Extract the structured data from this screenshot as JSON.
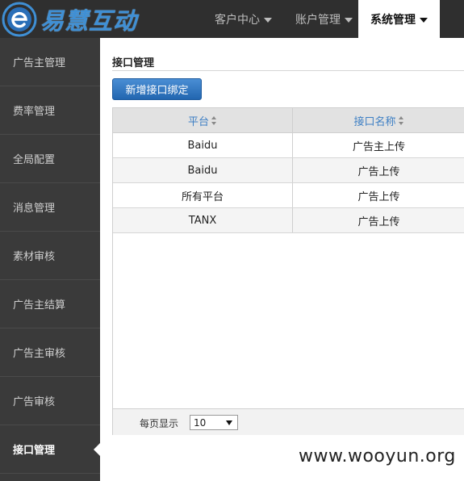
{
  "brand": {
    "logo_text": "易慧互动"
  },
  "nav": {
    "items": [
      {
        "label": "客户中心"
      },
      {
        "label": "账户管理"
      },
      {
        "label": "系统管理"
      }
    ]
  },
  "sidebar": {
    "items": [
      {
        "label": "广告主管理"
      },
      {
        "label": "费率管理"
      },
      {
        "label": "全局配置"
      },
      {
        "label": "消息管理"
      },
      {
        "label": "素材审核"
      },
      {
        "label": "广告主结算"
      },
      {
        "label": "广告主审核"
      },
      {
        "label": "广告审核"
      },
      {
        "label": "接口管理"
      }
    ]
  },
  "main": {
    "title": "接口管理",
    "add_button": "新增接口绑定",
    "table": {
      "columns": [
        "平台",
        "接口名称"
      ],
      "rows": [
        [
          "Baidu",
          "广告主上传"
        ],
        [
          "Baidu",
          "广告上传"
        ],
        [
          "所有平台",
          "广告上传"
        ],
        [
          "TANX",
          "广告上传"
        ]
      ]
    },
    "pager": {
      "label": "每页显示",
      "page_size": "10"
    }
  },
  "watermark": "www.wooyun.org",
  "colors": {
    "topbar": "#2f2f2f",
    "sidebar": "#3a3a3a",
    "accent": "#2a6fb8",
    "logo": "#3f8fd4"
  }
}
